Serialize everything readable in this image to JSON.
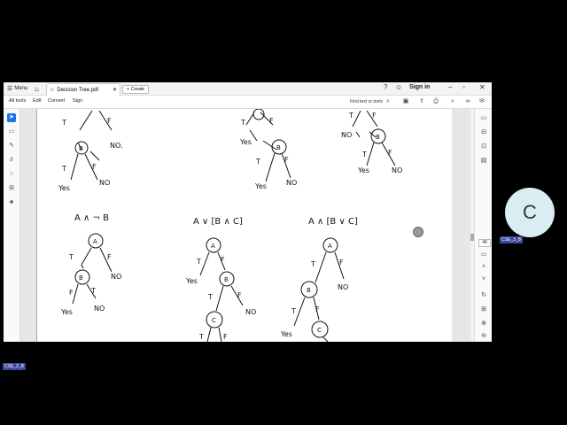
{
  "titlebar": {
    "menu_label": "Menu",
    "tab_title": "Decision Tree.pdf",
    "create_label": "Create",
    "sign_in_label": "Sign in"
  },
  "menubar": {
    "items": [
      "All tools",
      "Edit",
      "Convert",
      "Sign"
    ],
    "search_label": "Find text or tools"
  },
  "page_indicator": "49",
  "document": {
    "top_trees": {
      "left": {
        "labels": [
          "T",
          "F",
          "NO.",
          "T",
          "F",
          "Yes",
          "NO"
        ],
        "node": "B"
      },
      "middle": {
        "labels": [
          "T",
          "F",
          "Yes",
          "T",
          "F",
          "Yes",
          "NO"
        ],
        "node": "B"
      },
      "right": {
        "labels": [
          "T",
          "F",
          "NO",
          "T",
          "F",
          "Yes",
          "NO"
        ],
        "node": "B"
      }
    },
    "expressions": [
      "A ∧ ¬ B",
      "A ∨ [B ∧ C]",
      "A ∧ [B ∨ C]"
    ],
    "tree1": {
      "nodes": [
        "A",
        "B"
      ],
      "labels": [
        "T",
        "F",
        "NO",
        "F",
        "T",
        "Yes",
        "NO"
      ]
    },
    "tree2": {
      "nodes": [
        "A",
        "B",
        "C"
      ],
      "labels": [
        "T",
        "F",
        "Yes",
        "T",
        "F",
        "NO",
        "T",
        "F"
      ]
    },
    "tree3": {
      "nodes": [
        "A",
        "B",
        "C"
      ],
      "labels": [
        "T",
        "F",
        "NO",
        "T",
        "F",
        "Yes"
      ]
    }
  },
  "participant": {
    "avatar_letter": "C",
    "name_badge": "CSE_3_B"
  },
  "self_badge": "CSE_3_B"
}
